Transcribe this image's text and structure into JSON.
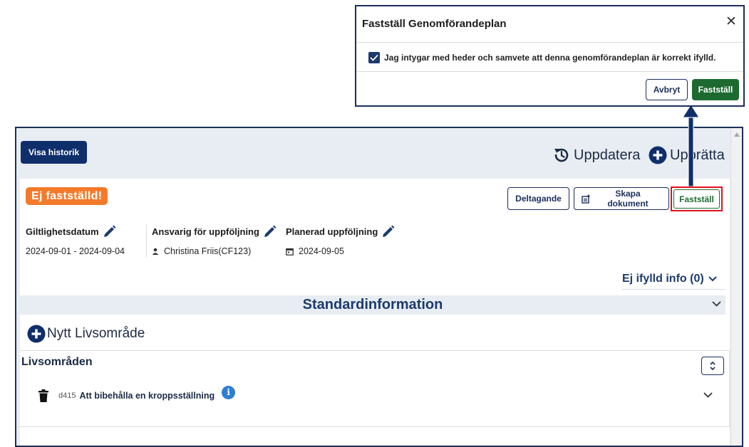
{
  "toolbar": {
    "history_label": "Visa historik",
    "update_label": "Uppdatera",
    "create_label": "Upprätta"
  },
  "status": {
    "badge_text": "Ej fastställd!",
    "badge_color": "#f47a2b"
  },
  "actions": {
    "participation_label": "Deltagande",
    "create_document_label": "Skapa dokument",
    "confirm_label": "Fastställ"
  },
  "meta": {
    "validity": {
      "label": "Giltlighetsdatum",
      "value": "2024-09-01 - 2024-09-04"
    },
    "responsible": {
      "label": "Ansvarig för uppföljning",
      "value": "Christina Friis(CF123)"
    },
    "planned": {
      "label": "Planerad uppföljning",
      "value": "2024-09-05"
    }
  },
  "incomplete_info": {
    "label": "Ej ifylld info (0)"
  },
  "section": {
    "title": "Standardinformation"
  },
  "life_areas": {
    "new_label": "Nytt Livsområde",
    "title": "Livsområden",
    "items": [
      {
        "code": "d415",
        "name": "Att bibehålla en kroppsställning"
      }
    ]
  },
  "dialog": {
    "title": "Fastställ Genomförandeplan",
    "consent_text": "Jag intygar med heder och samvete att denna genomförandeplan är korrekt ifylld.",
    "consent_checked": true,
    "cancel_label": "Avbryt",
    "confirm_label": "Fastställ"
  },
  "colors": {
    "navy": "#0f2f6b",
    "confirm_green": "#1d6a31",
    "highlight_red": "#e0101c",
    "info_blue": "#2d7fd1"
  },
  "icons": {
    "update": "history-refresh-icon",
    "create": "plus-circle-icon",
    "edit": "pencil-icon",
    "person": "person-icon",
    "calendar": "calendar-icon",
    "chevron": "chevron-down-icon",
    "sort": "sort-icon",
    "delete": "trash-icon",
    "info": "info-icon",
    "close": "close-icon",
    "check": "checkmark-icon"
  }
}
